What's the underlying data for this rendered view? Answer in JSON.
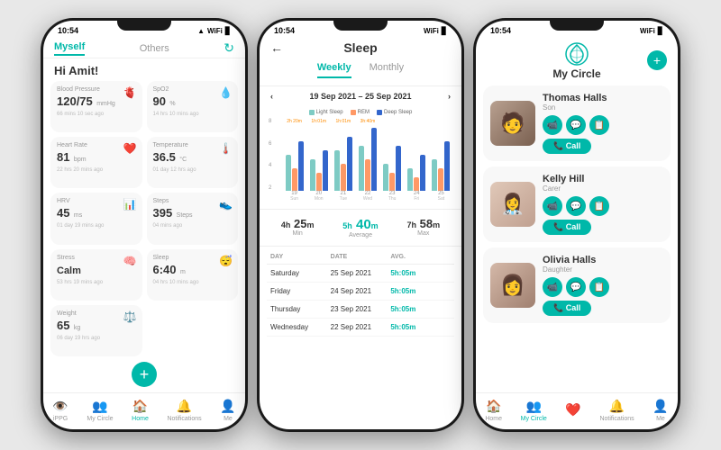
{
  "phone1": {
    "status_time": "10:54",
    "tab_myself": "Myself",
    "tab_others": "Others",
    "greeting": "Hi Amit!",
    "cards": [
      {
        "title": "Blood Pressure",
        "value": "120/75",
        "unit": "mmHg",
        "time": "66 mins 10 sec ago",
        "icon": "🫀"
      },
      {
        "title": "SpO2",
        "value": "90",
        "unit": "%",
        "time": "14 hrs 10 mins ago",
        "icon": "💧"
      },
      {
        "title": "Heart Rate",
        "value": "81",
        "unit": "bpm",
        "time": "22 hrs 20 mins ago",
        "icon": "❤️"
      },
      {
        "title": "Temperature",
        "value": "36.5",
        "unit": "°C",
        "time": "01 day 12 hrs ago",
        "icon": "🌡️"
      },
      {
        "title": "HRV",
        "value": "45",
        "unit": "milliseconds",
        "time": "01 day 19 mins ago",
        "icon": "📊"
      },
      {
        "title": "Steps",
        "value": "395",
        "unit": "Steps",
        "time": "04 mins ago",
        "icon": "👟"
      },
      {
        "title": "Stress",
        "value": "Calm",
        "unit": "",
        "time": "53 hrs 19 mins ago",
        "icon": "🧠"
      },
      {
        "title": "Sleep",
        "value": "6:40",
        "unit": "m",
        "time": "04 hrs 10 mins ago",
        "icon": "😴"
      },
      {
        "title": "Weight",
        "value": "65",
        "unit": "kg",
        "time": "06 day 19 hrs ago",
        "icon": "⚖️"
      }
    ],
    "nav": [
      "iPPG",
      "My Circle",
      "Home",
      "Notifications",
      "Me"
    ]
  },
  "phone2": {
    "status_time": "10:54",
    "title": "Sleep",
    "tab_weekly": "Weekly",
    "tab_monthly": "Monthly",
    "date_range": "19 Sep 2021 – 25 Sep 2021",
    "legend": [
      "Light Sleep",
      "REM",
      "Deep Sleep"
    ],
    "chart_days": [
      {
        "day": "19",
        "sub": "Sun",
        "light": 40,
        "rem": 25,
        "deep": 55
      },
      {
        "day": "20",
        "sub": "Mon",
        "light": 35,
        "rem": 20,
        "deep": 45
      },
      {
        "day": "21",
        "sub": "Tue",
        "light": 45,
        "rem": 30,
        "deep": 60
      },
      {
        "day": "22",
        "sub": "Wed",
        "light": 50,
        "rem": 35,
        "deep": 70
      },
      {
        "day": "23",
        "sub": "Thu",
        "light": 30,
        "rem": 20,
        "deep": 50
      },
      {
        "day": "24",
        "sub": "Fri",
        "light": 25,
        "rem": 15,
        "deep": 40
      },
      {
        "day": "25",
        "sub": "Sat",
        "light": 35,
        "rem": 25,
        "deep": 55
      }
    ],
    "min_label": "Min",
    "min_value": "4h 25m",
    "avg_label": "Average",
    "avg_value": "5h 40m",
    "max_label": "Max",
    "max_value": "7h 58m",
    "table_headers": [
      "DAY",
      "DATE",
      "AVG."
    ],
    "table_rows": [
      {
        "day": "Saturday",
        "date": "25 Sep 2021",
        "avg": "5h:05m"
      },
      {
        "day": "Friday",
        "date": "24 Sep 2021",
        "avg": "5h:05m"
      },
      {
        "day": "Thursday",
        "date": "23 Sep 2021",
        "avg": "5h:05m"
      },
      {
        "day": "Wednesday",
        "date": "22 Sep 2021",
        "avg": "5h:05m"
      }
    ]
  },
  "phone3": {
    "status_time": "10:54",
    "title": "My Circle",
    "contacts": [
      {
        "name": "Thomas Halls",
        "role": "Son",
        "avatar_label": "👨"
      },
      {
        "name": "Kelly Hill",
        "role": "Carer",
        "avatar_label": "👩‍⚕️"
      },
      {
        "name": "Olivia Halls",
        "role": "Daughter",
        "avatar_label": "👩"
      }
    ],
    "call_label": "📞 Call",
    "nav": [
      "Home",
      "My Circle",
      "♥",
      "Notifications",
      "Me"
    ]
  }
}
